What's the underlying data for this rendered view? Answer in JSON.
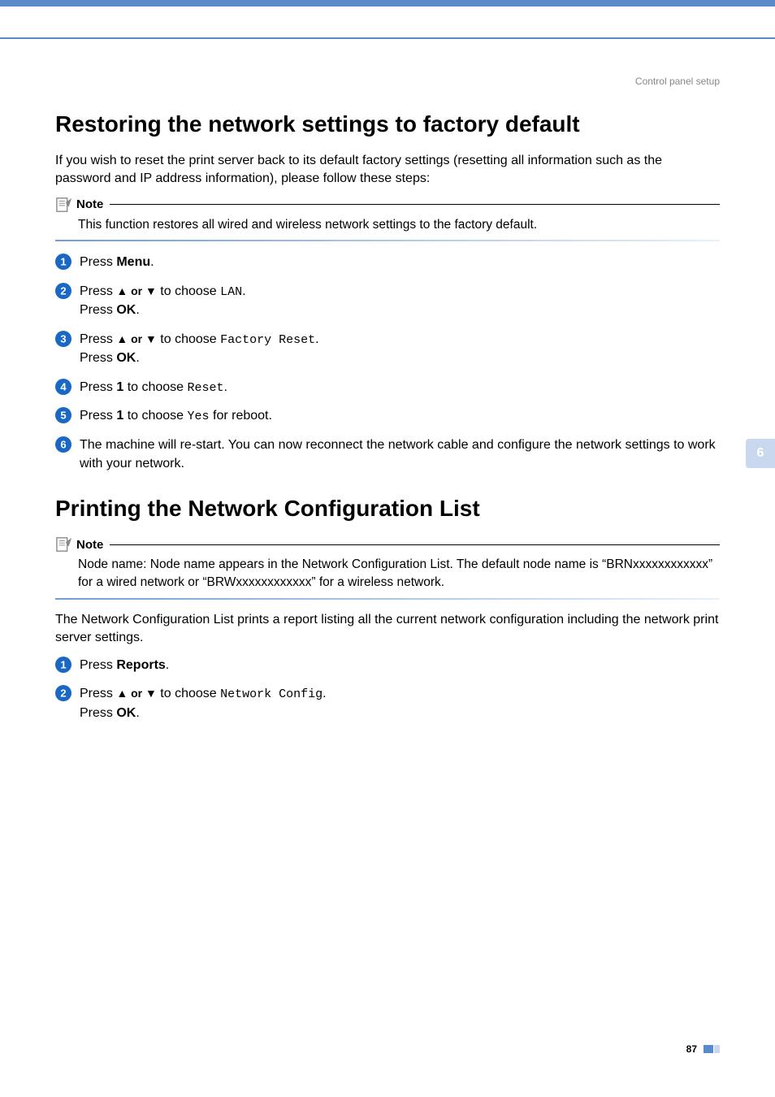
{
  "breadcrumb": "Control panel setup",
  "section1": {
    "title": "Restoring the network settings to factory default",
    "intro": "If you wish to reset the print server back to its default factory settings (resetting all information such as the password and IP address information), please follow these steps:",
    "note_label": "Note",
    "note_body": "This function restores all wired and wireless network settings to the factory default.",
    "steps": {
      "s1": {
        "press": "Press ",
        "menu": "Menu",
        "end": "."
      },
      "s2": {
        "press": "Press ",
        "arrows": "▲ or ▼",
        "choose": " to choose ",
        "code": "LAN",
        "end": ".",
        "press2": "Press ",
        "ok": "OK",
        "end2": "."
      },
      "s3": {
        "press": "Press ",
        "arrows": "▲ or ▼",
        "choose": " to choose ",
        "code": "Factory Reset",
        "end": ".",
        "press2": "Press ",
        "ok": "OK",
        "end2": "."
      },
      "s4": {
        "press": "Press ",
        "one": "1",
        "choose": " to choose ",
        "code": "Reset",
        "end": "."
      },
      "s5": {
        "press": "Press ",
        "one": "1",
        "choose": " to choose ",
        "code": "Yes",
        "after": " for reboot."
      },
      "s6": {
        "text": "The machine will re-start. You can now reconnect the network cable and configure the network settings to work with your network."
      }
    }
  },
  "section2": {
    "title": "Printing the Network Configuration List",
    "note_label": "Note",
    "note_body": "Node name: Node name appears in the Network Configuration List. The default node name is “BRNxxxxxxxxxxxx” for a wired network or “BRWxxxxxxxxxxxx” for a wireless network.",
    "intro": "The Network Configuration List prints a report listing all the current network configuration including the network print server settings.",
    "steps": {
      "s1": {
        "press": "Press ",
        "reports": "Reports",
        "end": "."
      },
      "s2": {
        "press": "Press ",
        "arrows": "▲ or ▼",
        "choose": " to choose ",
        "code": "Network Config",
        "end": ".",
        "press2": "Press ",
        "ok": "OK",
        "end2": "."
      }
    }
  },
  "side_tab": "6",
  "page_num": "87"
}
